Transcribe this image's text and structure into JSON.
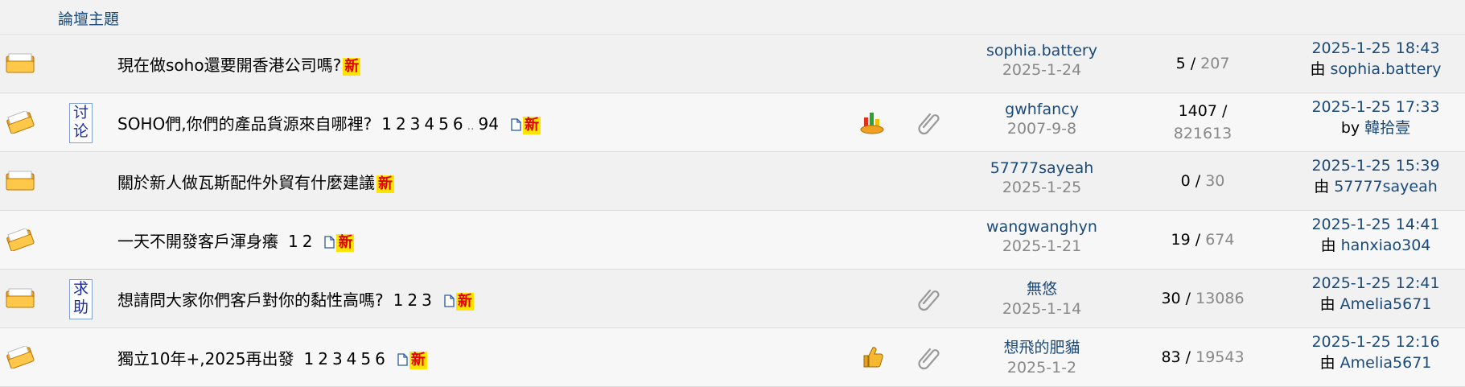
{
  "header": {
    "title": "論壇主題"
  },
  "threads": [
    {
      "subject": "現在做soho還要開香港公司嗎?",
      "tag": "",
      "pages": [],
      "ellipsis": "",
      "last_page": "",
      "has_page_icon": false,
      "new_label": "新",
      "author": "sophia.battery",
      "post_date": "2025-1-24",
      "replies": "5",
      "sep": "/",
      "views": "207",
      "last_time": "2025-1-25 18:43",
      "last_by": "由",
      "last_user": "sophia.battery",
      "icons": []
    },
    {
      "subject": "SOHO們,你們的產品貨源來自哪裡?",
      "tag": "讨论",
      "pages": [
        "1",
        "2",
        "3",
        "4",
        "5",
        "6"
      ],
      "ellipsis": "..",
      "last_page": "94",
      "has_page_icon": true,
      "new_label": "新",
      "author": "gwhfancy",
      "post_date": "2007-9-8",
      "replies": "1407",
      "sep": "/",
      "views": "821613",
      "last_time": "2025-1-25 17:33",
      "last_by": "by",
      "last_user": "韓拾壹",
      "icons": [
        "hot-icon",
        "attachment-icon"
      ]
    },
    {
      "subject": "關於新人做瓦斯配件外貿有什麼建議",
      "tag": "",
      "pages": [],
      "ellipsis": "",
      "last_page": "",
      "has_page_icon": false,
      "new_label": "新",
      "author": "57777sayeah",
      "post_date": "2025-1-25",
      "replies": "0",
      "sep": "/",
      "views": "30",
      "last_time": "2025-1-25 15:39",
      "last_by": "由",
      "last_user": "57777sayeah",
      "icons": []
    },
    {
      "subject": "一天不開發客戶渾身癢",
      "tag": "",
      "pages": [
        "1",
        "2"
      ],
      "ellipsis": "",
      "last_page": "",
      "has_page_icon": true,
      "new_label": "新",
      "author": "wangwanghyn",
      "post_date": "2025-1-21",
      "replies": "19",
      "sep": "/",
      "views": "674",
      "last_time": "2025-1-25 14:41",
      "last_by": "由",
      "last_user": "hanxiao304",
      "icons": []
    },
    {
      "subject": "想請問大家你們客戶對你的黏性高嗎?",
      "tag": "求助",
      "pages": [
        "1",
        "2",
        "3"
      ],
      "ellipsis": "",
      "last_page": "",
      "has_page_icon": true,
      "new_label": "新",
      "author": "無悠",
      "post_date": "2025-1-14",
      "replies": "30",
      "sep": "/",
      "views": "13086",
      "last_time": "2025-1-25 12:41",
      "last_by": "由",
      "last_user": "Amelia5671",
      "icons": [
        "attachment-icon"
      ]
    },
    {
      "subject": "獨立10年+,2025再出發",
      "tag": "",
      "pages": [
        "1",
        "2",
        "3",
        "4",
        "5",
        "6"
      ],
      "ellipsis": "",
      "last_page": "",
      "has_page_icon": true,
      "new_label": "新",
      "author": "想飛的肥貓",
      "post_date": "2025-1-2",
      "replies": "83",
      "sep": "/",
      "views": "19543",
      "last_time": "2025-1-25 12:16",
      "last_by": "由",
      "last_user": "Amelia5671",
      "icons": [
        "thumbs-up-icon",
        "attachment-icon"
      ]
    }
  ]
}
